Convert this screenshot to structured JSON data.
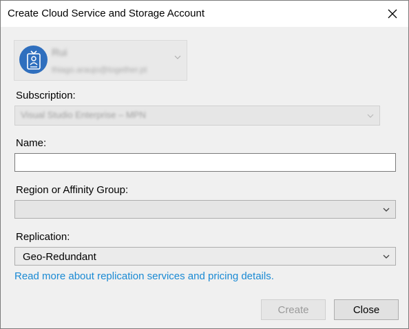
{
  "window": {
    "title": "Create Cloud Service and Storage Account"
  },
  "account": {
    "name": "Rui",
    "email": "thiago.araujo@together.pt",
    "avatar_icon": "id-badge-icon"
  },
  "subscription": {
    "label": "Subscription:",
    "value": "Visual Studio Enterprise – MPN"
  },
  "name": {
    "label": "Name:",
    "value": ""
  },
  "region": {
    "label": "Region or Affinity Group:",
    "value": ""
  },
  "replication": {
    "label": "Replication:",
    "value": "Geo-Redundant"
  },
  "link": {
    "text": "Read more about replication services and pricing details."
  },
  "buttons": {
    "create": "Create",
    "close": "Close"
  },
  "colors": {
    "link": "#1a8ad4",
    "avatar_bg": "#2f6fbe",
    "dialog_bg": "#f0f0f0"
  }
}
